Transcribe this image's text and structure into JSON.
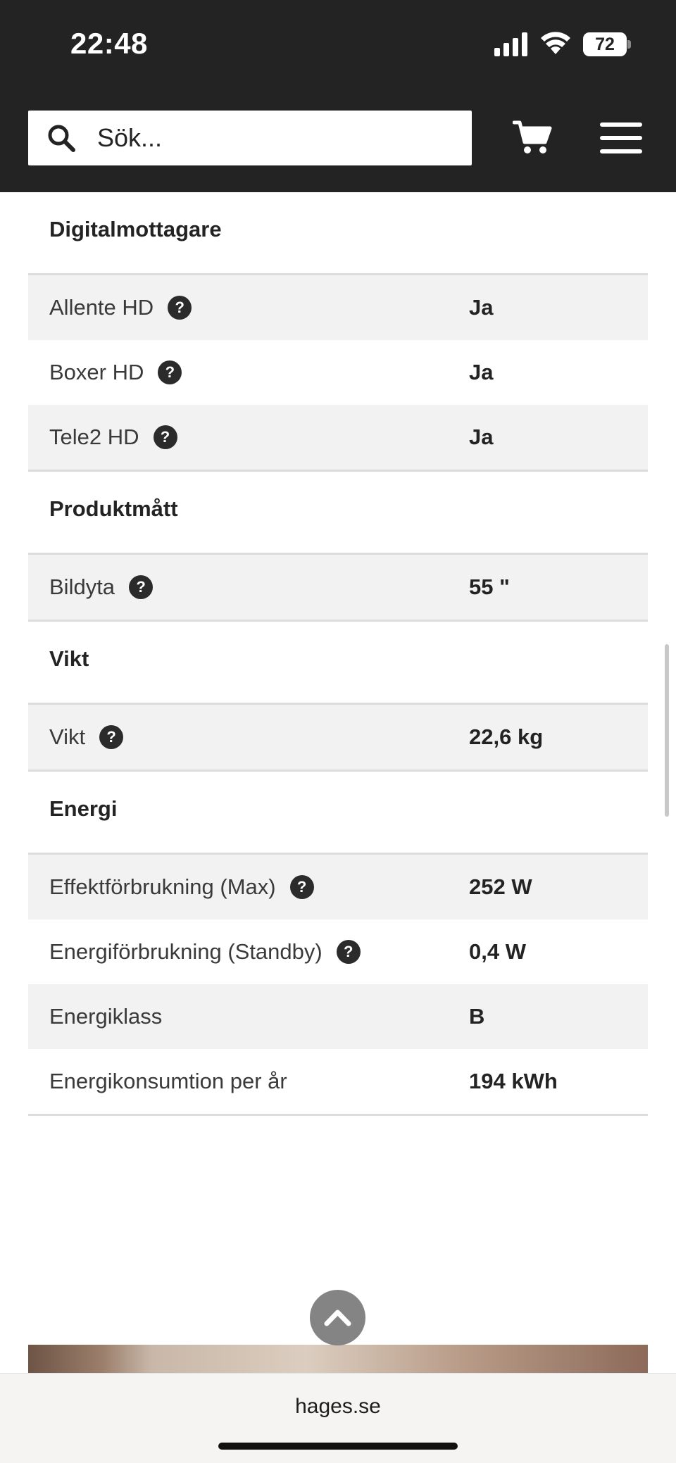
{
  "status_bar": {
    "time": "22:48",
    "battery": "72"
  },
  "header": {
    "search_placeholder": "Sök..."
  },
  "specs": {
    "sections": [
      {
        "title": "Digitalmottagare",
        "rows": [
          {
            "label": "Allente HD",
            "value": "Ja",
            "help": "?"
          },
          {
            "label": "Boxer HD",
            "value": "Ja",
            "help": "?"
          },
          {
            "label": "Tele2 HD",
            "value": "Ja",
            "help": "?"
          }
        ]
      },
      {
        "title": "Produktmått",
        "rows": [
          {
            "label": "Bildyta",
            "value": "55 \"",
            "help": "?"
          }
        ]
      },
      {
        "title": "Vikt",
        "rows": [
          {
            "label": "Vikt",
            "value": "22,6 kg",
            "help": "?"
          }
        ]
      },
      {
        "title": "Energi",
        "rows": [
          {
            "label": "Effektförbrukning (Max)",
            "value": "252 W",
            "help": "?"
          },
          {
            "label": "Energiförbrukning (Standby)",
            "value": "0,4 W",
            "help": "?"
          },
          {
            "label": "Energiklass",
            "value": "B"
          },
          {
            "label": "Energikonsumtion per år",
            "value": "194 kWh"
          }
        ]
      }
    ]
  },
  "browser": {
    "url": "hages.se"
  },
  "colors": {
    "header_bg": "#232323",
    "row_shade": "#f2f2f2",
    "divider": "#dcdcdc"
  }
}
